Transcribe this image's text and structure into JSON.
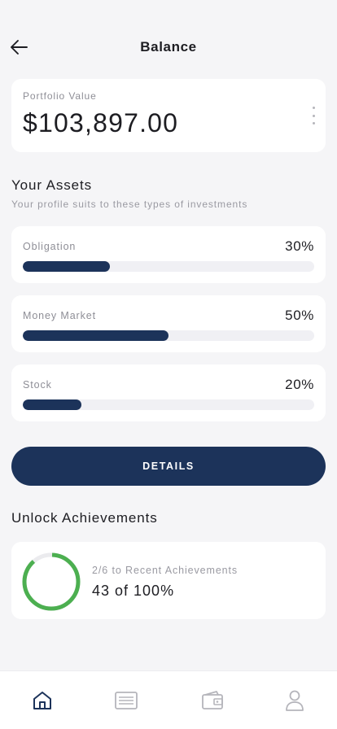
{
  "header": {
    "title": "Balance",
    "back_icon": "arrow-left-icon"
  },
  "portfolio": {
    "label": "Portfolio Value",
    "value": "$103,897.00",
    "menu_icon": "more-vertical-icon"
  },
  "assets": {
    "title": "Your Assets",
    "subtitle": "Your profile suits to these types of investments",
    "items": [
      {
        "label": "Obligation",
        "percent_text": "30%",
        "percent": 30
      },
      {
        "label": "Money Market",
        "percent_text": "50%",
        "percent": 50
      },
      {
        "label": "Stock",
        "percent_text": "20%",
        "percent": 20
      }
    ]
  },
  "details_button": {
    "label": "DETAILS"
  },
  "achievements": {
    "title": "Unlock Achievements",
    "subtitle": "2/6 to Recent Achievements",
    "progress_text": "43 of 100%",
    "progress_fraction": 0.43
  },
  "bottom_nav": {
    "items": [
      {
        "icon": "home-icon",
        "active": true
      },
      {
        "icon": "list-icon",
        "active": false
      },
      {
        "icon": "wallet-icon",
        "active": false
      },
      {
        "icon": "profile-icon",
        "active": false
      }
    ]
  },
  "colors": {
    "accent": "#1c335a",
    "progress_track": "#f0f0f4",
    "ring_progress": "#4caf50",
    "ring_track": "#ebebee",
    "background": "#f5f5f7",
    "card": "#ffffff"
  }
}
